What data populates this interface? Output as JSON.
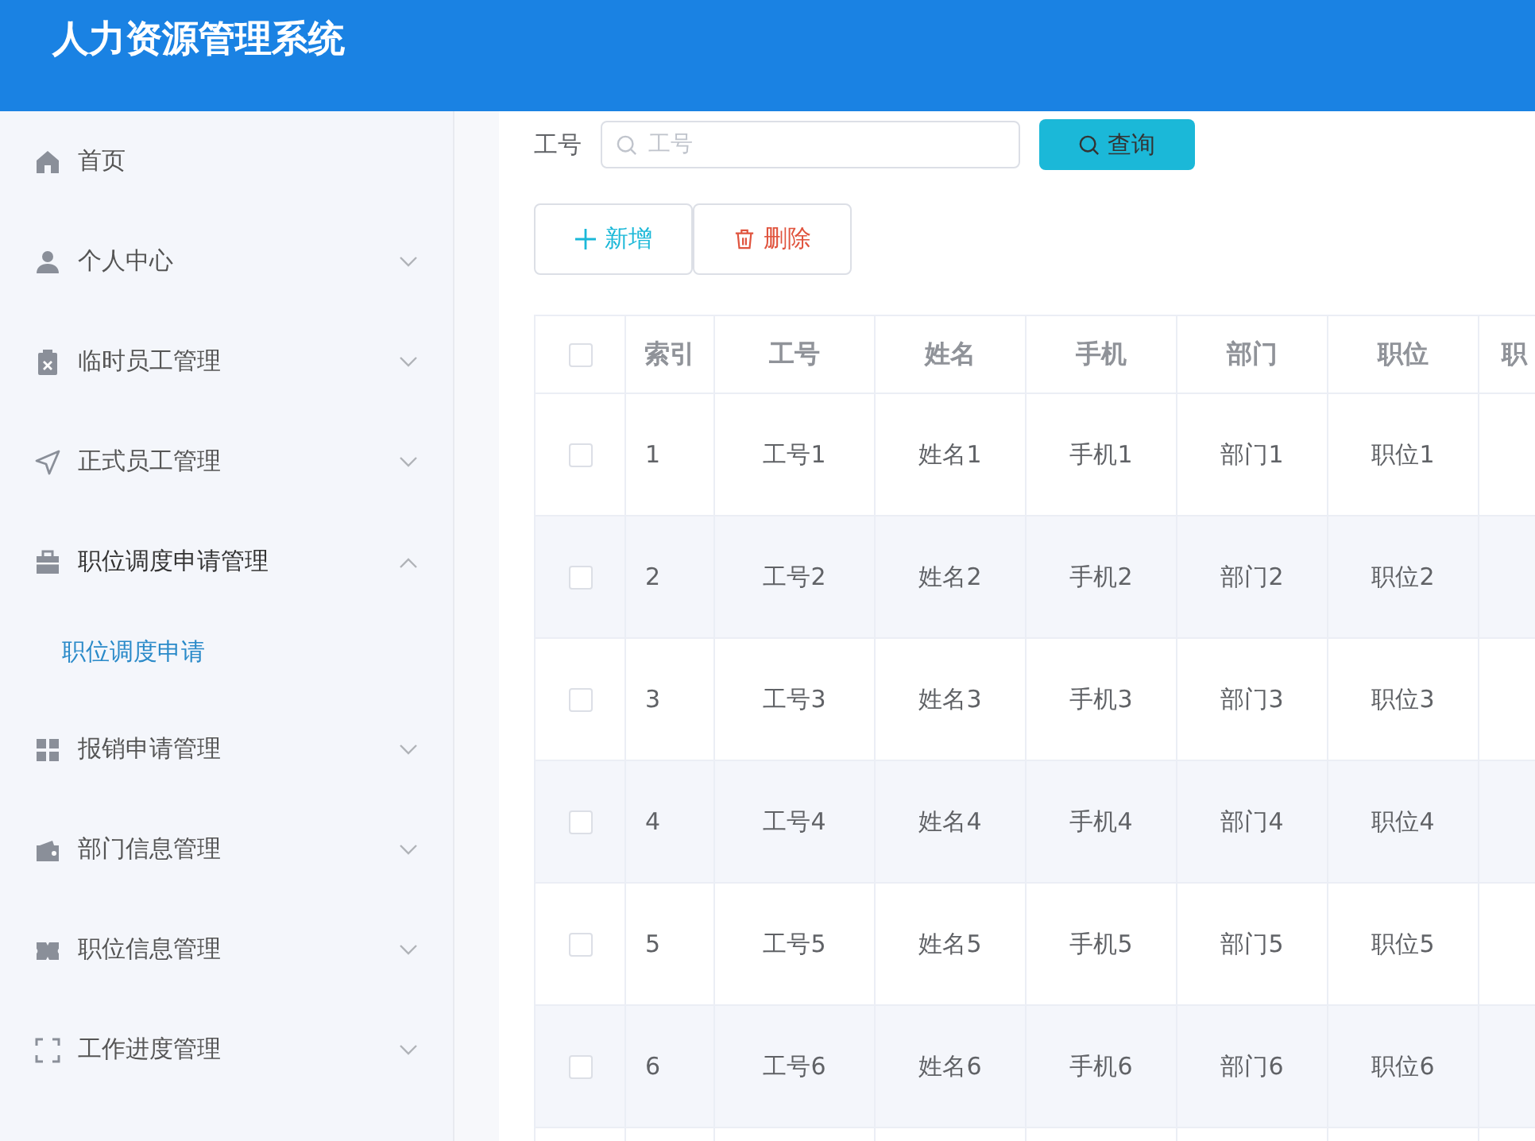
{
  "header": {
    "title": "人力资源管理系统"
  },
  "sidebar": {
    "items": [
      {
        "label": "首页",
        "kind": "link"
      },
      {
        "label": "个人中心",
        "kind": "submenu",
        "expanded": false
      },
      {
        "label": "临时员工管理",
        "kind": "submenu",
        "expanded": false
      },
      {
        "label": "正式员工管理",
        "kind": "submenu",
        "expanded": false
      },
      {
        "label": "职位调度申请管理",
        "kind": "submenu",
        "expanded": true,
        "children": [
          {
            "label": "职位调度申请",
            "selected": true
          }
        ]
      },
      {
        "label": "报销申请管理",
        "kind": "submenu",
        "expanded": false
      },
      {
        "label": "部门信息管理",
        "kind": "submenu",
        "expanded": false
      },
      {
        "label": "职位信息管理",
        "kind": "submenu",
        "expanded": false
      },
      {
        "label": "工作进度管理",
        "kind": "submenu",
        "expanded": false
      }
    ]
  },
  "search": {
    "label": "工号",
    "placeholder": "工号",
    "button": "查询"
  },
  "actions": [
    {
      "label": "新增",
      "kind": "add"
    },
    {
      "label": "删除",
      "kind": "delete"
    }
  ],
  "table": {
    "select_all": {
      "checked": false
    },
    "columns": [
      "索引",
      "工号",
      "姓名",
      "手机",
      "部门",
      "职位",
      "职"
    ],
    "rows": [
      {
        "checked": false,
        "cells": [
          "1",
          "工号1",
          "姓名1",
          "手机1",
          "部门1",
          "职位1",
          ""
        ]
      },
      {
        "checked": false,
        "cells": [
          "2",
          "工号2",
          "姓名2",
          "手机2",
          "部门2",
          "职位2",
          ""
        ]
      },
      {
        "checked": false,
        "cells": [
          "3",
          "工号3",
          "姓名3",
          "手机3",
          "部门3",
          "职位3",
          ""
        ]
      },
      {
        "checked": false,
        "cells": [
          "4",
          "工号4",
          "姓名4",
          "手机4",
          "部门4",
          "职位4",
          ""
        ]
      },
      {
        "checked": false,
        "cells": [
          "5",
          "工号5",
          "姓名5",
          "手机5",
          "部门5",
          "职位5",
          ""
        ]
      },
      {
        "checked": false,
        "cells": [
          "6",
          "工号6",
          "姓名6",
          "手机6",
          "部门6",
          "职位6",
          ""
        ]
      }
    ]
  }
}
